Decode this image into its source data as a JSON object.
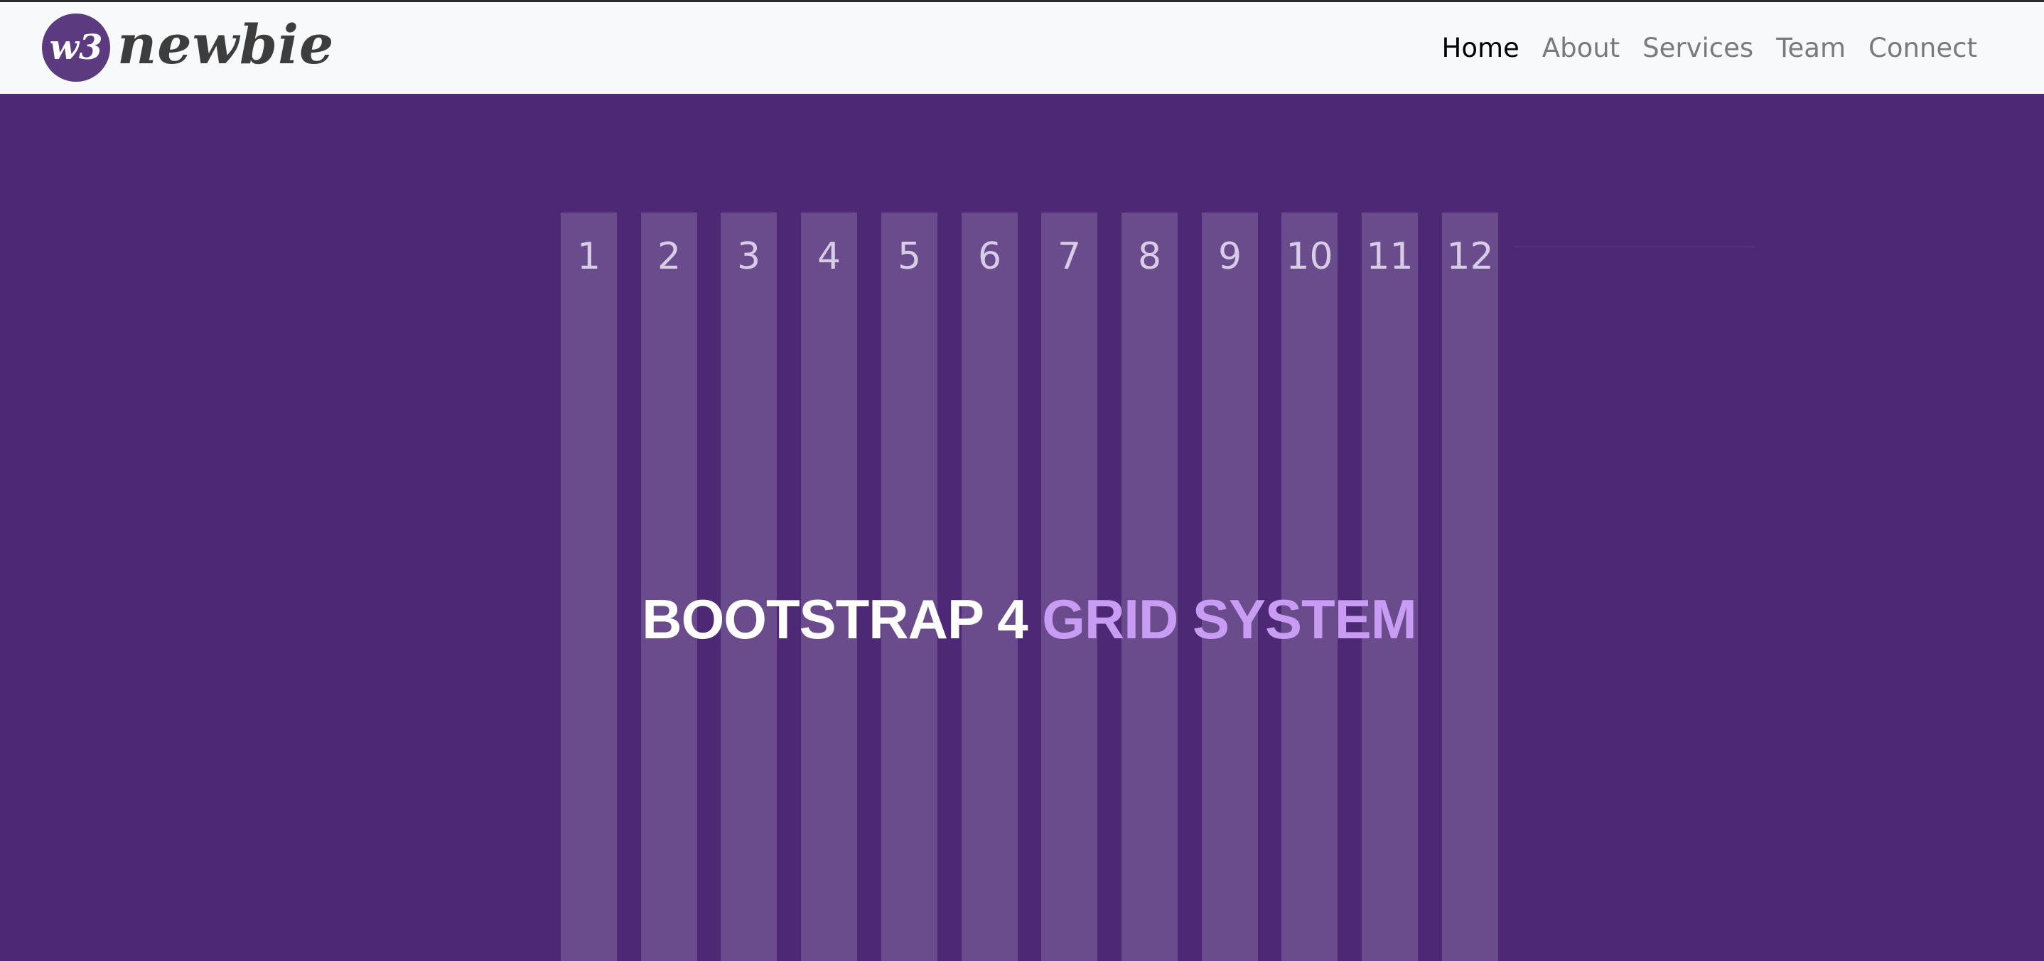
{
  "navbar": {
    "brand_text": "newbie",
    "logo_text": "w3",
    "links": [
      {
        "label": "Home",
        "active": true
      },
      {
        "label": "About",
        "active": false
      },
      {
        "label": "Services",
        "active": false
      },
      {
        "label": "Team",
        "active": false
      },
      {
        "label": "Connect",
        "active": false
      }
    ]
  },
  "hero": {
    "columns": [
      "1",
      "2",
      "3",
      "4",
      "5",
      "6",
      "7",
      "8",
      "9",
      "10",
      "11",
      "12"
    ],
    "title_part1": "BOOTSTRAP 4",
    "title_part2": "GRID SYSTEM"
  },
  "colors": {
    "hero_bg": "#4d2874",
    "column": "#6a4b8c",
    "accent": "#c79cf2",
    "navbar_bg": "#f8f9fa",
    "logo_circle": "#5b3a80"
  }
}
